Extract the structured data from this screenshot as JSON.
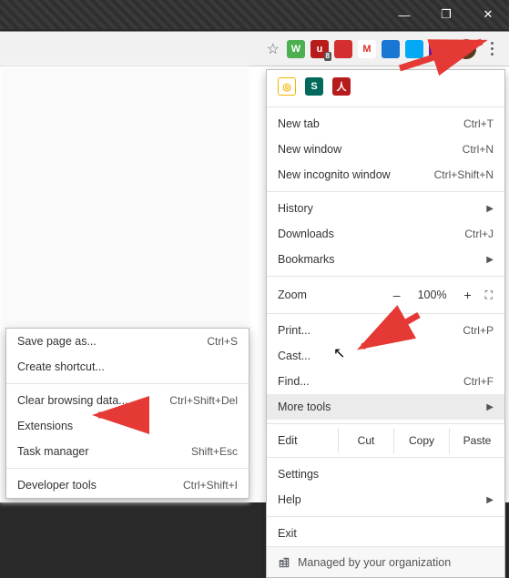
{
  "window": {
    "minimize": "—",
    "maximize": "❐",
    "close": "✕"
  },
  "toolbar": {
    "star": "☆",
    "extensions": [
      {
        "bg": "#4caf50",
        "txt": "W"
      },
      {
        "bg": "#b71c1c",
        "txt": "u",
        "badge": "8"
      },
      {
        "bg": "#d32f2f",
        "txt": ""
      },
      {
        "bg": "#ffffff",
        "txt": "M",
        "color": "#d93025"
      },
      {
        "bg": "#1976d2",
        "txt": ""
      },
      {
        "bg": "#03a9f4",
        "txt": ""
      },
      {
        "bg": "#6a1b9a",
        "txt": ""
      }
    ]
  },
  "main_menu": {
    "ext_icons": [
      {
        "bg": "#fff",
        "border": "#f4b400",
        "inner": "◎"
      },
      {
        "bg": "#00695c",
        "txt": "S"
      },
      {
        "bg": "#b71c1c",
        "txt": "人"
      }
    ],
    "items1": [
      {
        "label": "New tab",
        "shortcut": "Ctrl+T"
      },
      {
        "label": "New window",
        "shortcut": "Ctrl+N"
      },
      {
        "label": "New incognito window",
        "shortcut": "Ctrl+Shift+N"
      }
    ],
    "items2": [
      {
        "label": "History",
        "submenu": true
      },
      {
        "label": "Downloads",
        "shortcut": "Ctrl+J"
      },
      {
        "label": "Bookmarks",
        "submenu": true
      }
    ],
    "zoom": {
      "label": "Zoom",
      "minus": "–",
      "value": "100%",
      "plus": "+",
      "fs": "⛶"
    },
    "items3": [
      {
        "label": "Print...",
        "shortcut": "Ctrl+P"
      },
      {
        "label": "Cast..."
      },
      {
        "label": "Find...",
        "shortcut": "Ctrl+F"
      },
      {
        "label": "More tools",
        "submenu": true,
        "highlight": true
      }
    ],
    "edit": {
      "label": "Edit",
      "cut": "Cut",
      "copy": "Copy",
      "paste": "Paste"
    },
    "items4": [
      {
        "label": "Settings"
      },
      {
        "label": "Help",
        "submenu": true
      }
    ],
    "items5": [
      {
        "label": "Exit"
      }
    ],
    "managed": "Managed by your organization"
  },
  "sub_menu": {
    "items1": [
      {
        "label": "Save page as...",
        "shortcut": "Ctrl+S"
      },
      {
        "label": "Create shortcut..."
      }
    ],
    "items2": [
      {
        "label": "Clear browsing data...",
        "shortcut": "Ctrl+Shift+Del"
      },
      {
        "label": "Extensions"
      },
      {
        "label": "Task manager",
        "shortcut": "Shift+Esc"
      }
    ],
    "items3": [
      {
        "label": "Developer tools",
        "shortcut": "Ctrl+Shift+I"
      }
    ]
  }
}
